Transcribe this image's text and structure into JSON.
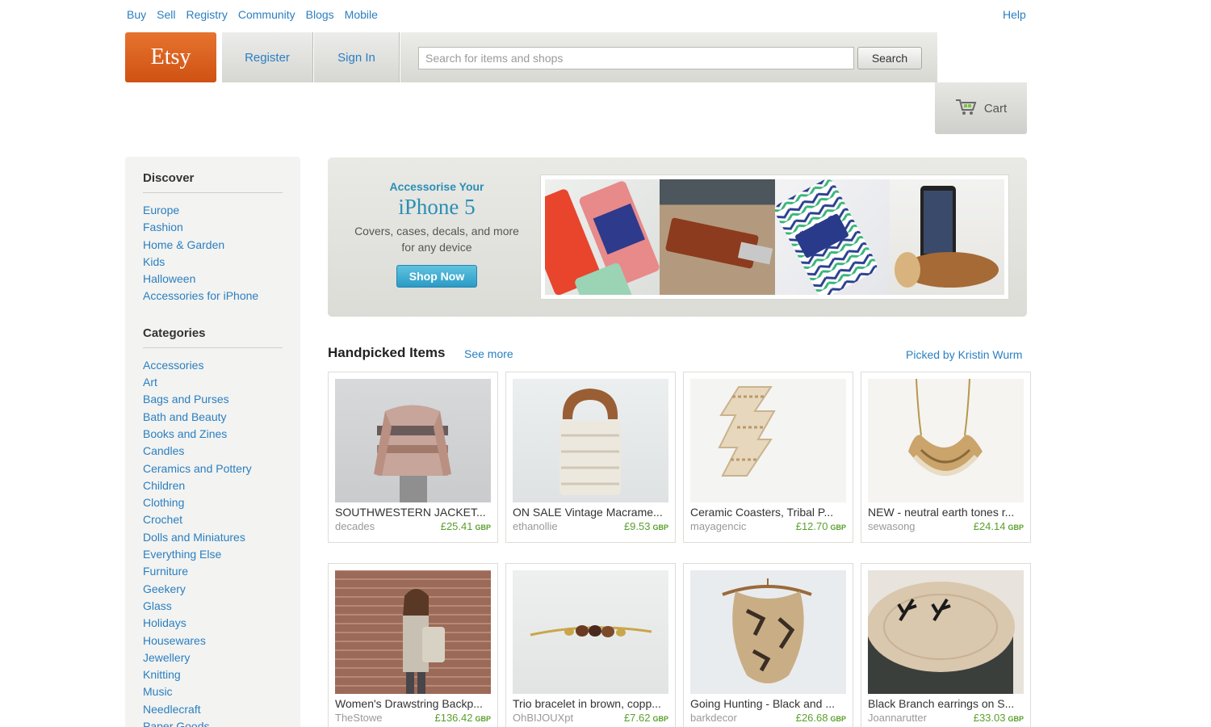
{
  "topnav": {
    "items": [
      "Buy",
      "Sell",
      "Registry",
      "Community",
      "Blogs",
      "Mobile"
    ],
    "help": "Help"
  },
  "header": {
    "logo": "Etsy",
    "register": "Register",
    "signin": "Sign In",
    "search_placeholder": "Search for items and shops",
    "search_button": "Search",
    "cart": "Cart"
  },
  "sidebar": {
    "discover_heading": "Discover",
    "discover": [
      "Europe",
      "Fashion",
      "Home & Garden",
      "Kids",
      "Halloween",
      "Accessories for iPhone"
    ],
    "categories_heading": "Categories",
    "categories": [
      "Accessories",
      "Art",
      "Bags and Purses",
      "Bath and Beauty",
      "Books and Zines",
      "Candles",
      "Ceramics and Pottery",
      "Children",
      "Clothing",
      "Crochet",
      "Dolls and Miniatures",
      "Everything Else",
      "Furniture",
      "Geekery",
      "Glass",
      "Holidays",
      "Housewares",
      "Jewellery",
      "Knitting",
      "Music",
      "Needlecraft",
      "Paper Goods"
    ]
  },
  "banner": {
    "subtitle": "Accessorise Your",
    "title": "iPhone 5",
    "description": "Covers, cases, decals, and more for any device",
    "button": "Shop Now"
  },
  "handpicked": {
    "title": "Handpicked Items",
    "see_more": "See more",
    "picked_by": "Picked by Kristin Wurm",
    "items": [
      {
        "title": "SOUTHWESTERN JACKET...",
        "shop": "decades",
        "price": "£25.41",
        "currency": "GBP"
      },
      {
        "title": "ON SALE Vintage Macrame...",
        "shop": "ethanollie",
        "price": "£9.53",
        "currency": "GBP"
      },
      {
        "title": "Ceramic Coasters, Tribal P...",
        "shop": "mayagencic",
        "price": "£12.70",
        "currency": "GBP"
      },
      {
        "title": "NEW - neutral earth tones r...",
        "shop": "sewasong",
        "price": "£24.14",
        "currency": "GBP"
      },
      {
        "title": "Women's Drawstring Backp...",
        "shop": "TheStowe",
        "price": "£136.42",
        "currency": "GBP"
      },
      {
        "title": "Trio bracelet in brown, copp...",
        "shop": "OhBIJOUXpt",
        "price": "£7.62",
        "currency": "GBP"
      },
      {
        "title": "Going Hunting - Black and ...",
        "shop": "barkdecor",
        "price": "£26.68",
        "currency": "GBP"
      },
      {
        "title": "Black Branch earrings on S...",
        "shop": "Joannarutter",
        "price": "£33.03",
        "currency": "GBP"
      }
    ]
  }
}
